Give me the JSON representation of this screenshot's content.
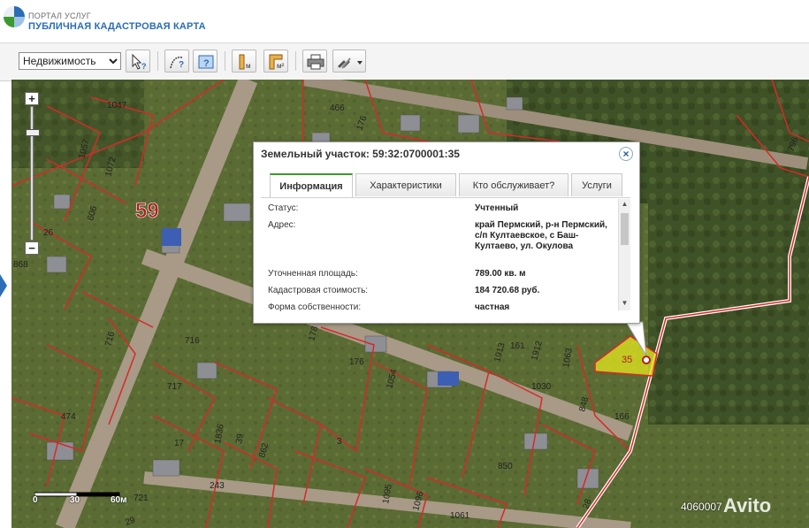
{
  "header": {
    "portal_top": "ПОРТАЛ УСЛУГ",
    "portal_main": "ПУБЛИЧНАЯ КАДАСТРОВАЯ КАРТА"
  },
  "toolbar": {
    "layer_selected": "Недвижимость",
    "buttons": [
      "select-info-tool",
      "measure-tool",
      "help-tool",
      "measure-length-tool",
      "measure-area-tool",
      "print-tool",
      "link-tool"
    ]
  },
  "popup": {
    "title": "Земельный участок: 59:32:0700001:35",
    "tabs": [
      "Информация",
      "Характеристики",
      "Кто обслуживает?",
      "Услуги"
    ],
    "rows": [
      {
        "label": "Статус:",
        "value": "Учтенный"
      },
      {
        "label": "Адрес:",
        "value": "край Пермский, р-н Пермский, с/п Култаевское, с Баш-Култаево, ул. Окулова"
      },
      {
        "label": "Уточненная площадь:",
        "value": "789.00 кв. м"
      },
      {
        "label": "Кадастровая стоимость:",
        "value": "184 720.68 руб."
      },
      {
        "label": "Форма собственности:",
        "value": "частная"
      }
    ]
  },
  "map": {
    "region_label": "59",
    "selected_parcel": "35",
    "parcel_labels": [
      "1047",
      "466",
      "176",
      "1057",
      "1072",
      "606",
      "26",
      "868",
      "716",
      "716",
      "717",
      "178",
      "176",
      "1054",
      "1913",
      "161",
      "1912",
      "1063",
      "1030",
      "848",
      "166",
      "474",
      "17",
      "1836",
      "39",
      "862",
      "3",
      "243",
      "1095",
      "1096",
      "1061",
      "850",
      "721",
      "28",
      "29",
      "796"
    ],
    "scale_labels": [
      "0",
      "30",
      "60м"
    ],
    "bottom_number": "4060007",
    "watermark": "Avito"
  },
  "colors": {
    "accent_green": "#3b9a2e",
    "brand_blue": "#2a6db5",
    "parcel_border": "#d8282a",
    "selected_parcel": "#e6e81e"
  }
}
